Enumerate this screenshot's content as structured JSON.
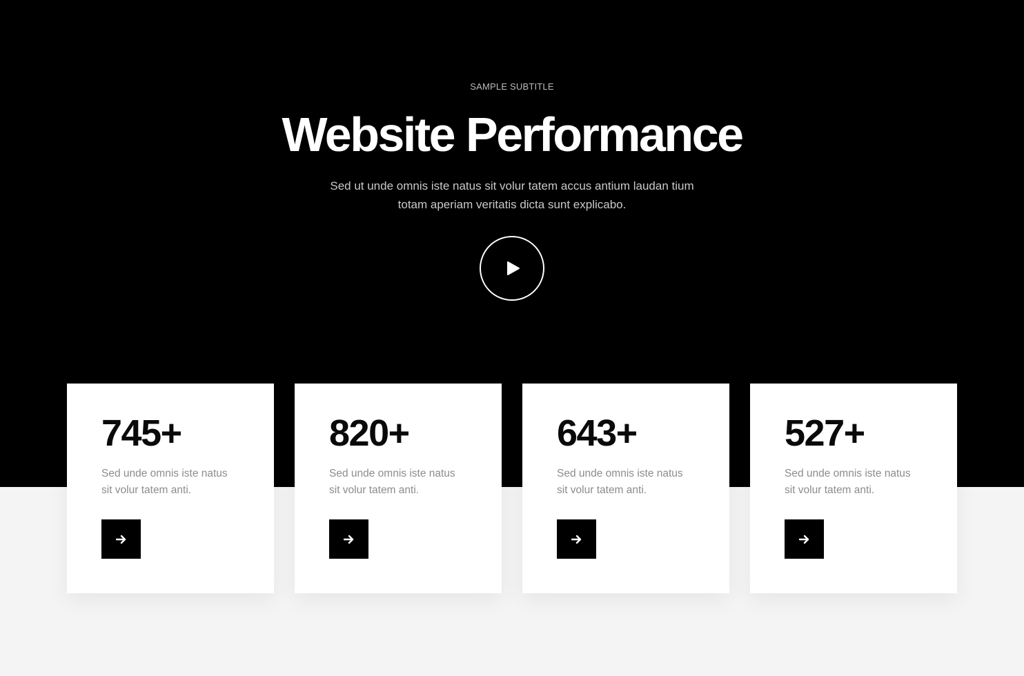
{
  "hero": {
    "subtitle": "SAMPLE SUBTITLE",
    "title": "Website Performance",
    "description": "Sed ut unde omnis iste natus sit volur tatem accus antium laudan tium totam aperiam veritatis dicta sunt explicabo.",
    "play_icon": "play-icon"
  },
  "stats": [
    {
      "number": "745+",
      "text": "Sed unde omnis iste natus sit volur tatem anti.",
      "icon": "arrow-right-icon"
    },
    {
      "number": "820+",
      "text": "Sed unde omnis iste natus sit volur tatem anti.",
      "icon": "arrow-right-icon"
    },
    {
      "number": "643+",
      "text": "Sed unde omnis iste natus sit volur tatem anti.",
      "icon": "arrow-right-icon"
    },
    {
      "number": "527+",
      "text": "Sed unde omnis iste natus sit volur tatem anti.",
      "icon": "arrow-right-icon"
    }
  ],
  "colors": {
    "hero_bg": "#000000",
    "page_bg": "#f4f4f4",
    "card_bg": "#ffffff",
    "accent": "#000000"
  }
}
